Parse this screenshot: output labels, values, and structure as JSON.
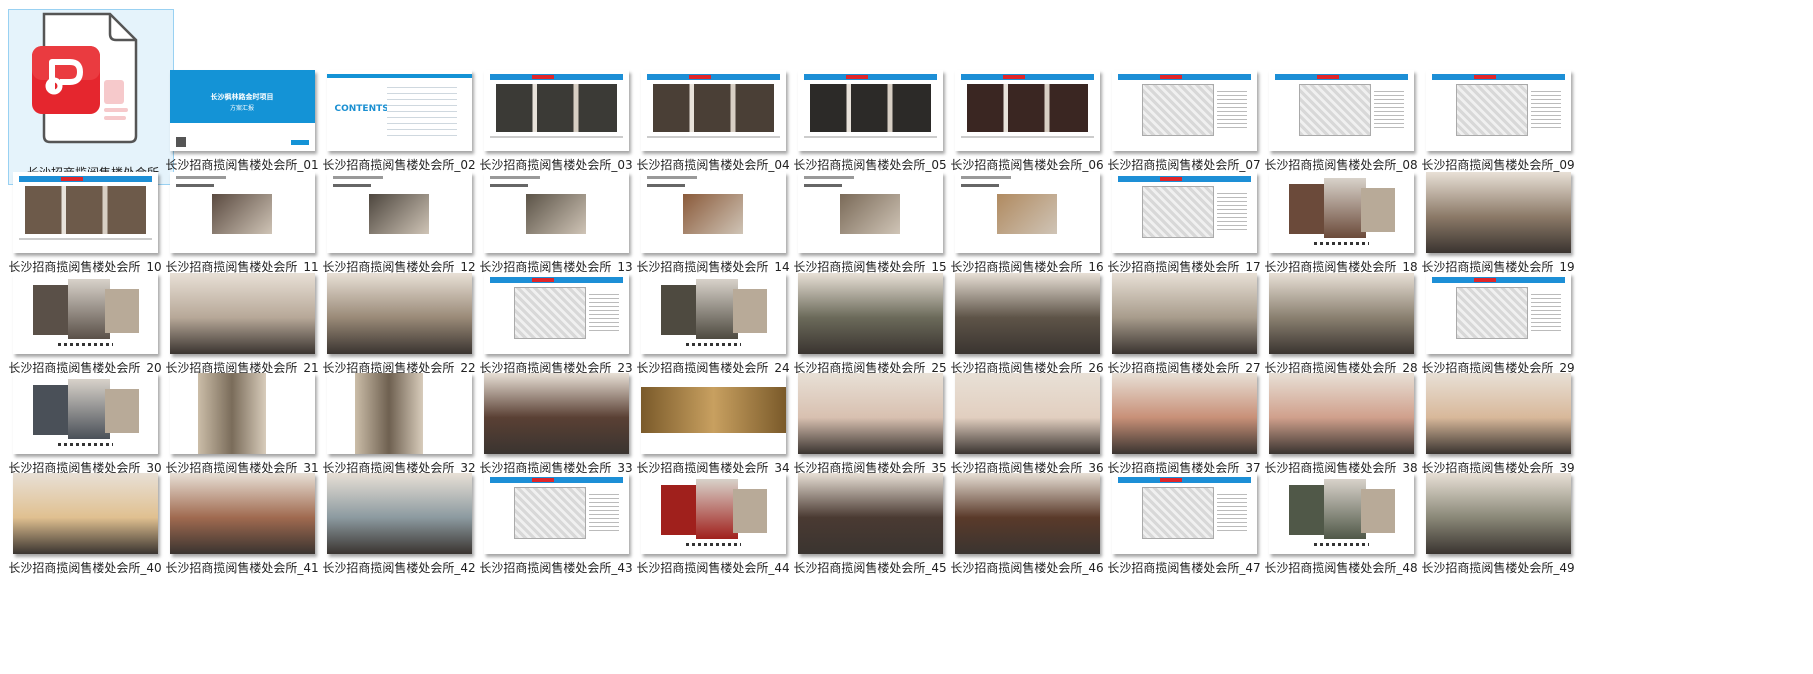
{
  "selected_file": {
    "name": "长沙招商揽阅售楼处会所",
    "icon": "pdf-file-icon",
    "accent": "#e5262e"
  },
  "thumbnails": [
    {
      "name": "长沙招商揽阅售楼处会所_01",
      "kind": "blue-cover",
      "title": "长沙枫林路金时项目",
      "subtitle": "方案汇报"
    },
    {
      "name": "长沙招商揽阅售楼处会所_02",
      "kind": "contents",
      "word": "CONTENTS"
    },
    {
      "name": "长沙招商揽阅售楼处会所_03",
      "kind": "header-photo",
      "tone": "#3b3a36"
    },
    {
      "name": "长沙招商揽阅售楼处会所_04",
      "kind": "header-photo",
      "tone": "#4a3f36"
    },
    {
      "name": "长沙招商揽阅售楼处会所_05",
      "kind": "header-photo",
      "tone": "#2c2a28"
    },
    {
      "name": "长沙招商揽阅售楼处会所_06",
      "kind": "header-photo",
      "tone": "#3a2622"
    },
    {
      "name": "长沙招商揽阅售楼处会所_07",
      "kind": "header-plan"
    },
    {
      "name": "长沙招商揽阅售楼处会所_08",
      "kind": "header-plan"
    },
    {
      "name": "长沙招商揽阅售楼处会所_09",
      "kind": "header-plan"
    },
    {
      "name": "长沙招商揽阅售楼处会所_10",
      "kind": "header-photo",
      "tone": "#6d5a4a"
    },
    {
      "name": "长沙招商揽阅售楼处会所_11",
      "kind": "doc",
      "tone": "#5a4a40"
    },
    {
      "name": "长沙招商揽阅售楼处会所_12",
      "kind": "doc",
      "tone": "#4d463e"
    },
    {
      "name": "长沙招商揽阅售楼处会所_13",
      "kind": "doc",
      "tone": "#5b5347"
    },
    {
      "name": "长沙招商揽阅售楼处会所_14",
      "kind": "doc",
      "tone": "#8a5a3a"
    },
    {
      "name": "长沙招商揽阅售楼处会所_15",
      "kind": "doc",
      "tone": "#7a6a58"
    },
    {
      "name": "长沙招商揽阅售楼处会所_16",
      "kind": "doc",
      "tone": "#b08a60"
    },
    {
      "name": "长沙招商揽阅售楼处会所_17",
      "kind": "header-plan"
    },
    {
      "name": "长沙招商揽阅售楼处会所_18",
      "kind": "collage",
      "tone": "#6b4a3a"
    },
    {
      "name": "长沙招商揽阅售楼处会所_19",
      "kind": "render",
      "tone": "#8c7a68"
    },
    {
      "name": "长沙招商揽阅售楼处会所_20",
      "kind": "collage",
      "tone": "#5a5048"
    },
    {
      "name": "长沙招商揽阅售楼处会所_21",
      "kind": "render",
      "tone": "#b7a898"
    },
    {
      "name": "长沙招商揽阅售楼处会所_22",
      "kind": "render",
      "tone": "#9a8a78"
    },
    {
      "name": "长沙招商揽阅售楼处会所_23",
      "kind": "header-plan"
    },
    {
      "name": "长沙招商揽阅售楼处会所_24",
      "kind": "collage",
      "tone": "#4e4a40"
    },
    {
      "name": "长沙招商揽阅售楼处会所_25",
      "kind": "render",
      "tone": "#6b6a5a"
    },
    {
      "name": "长沙招商揽阅售楼处会所_26",
      "kind": "render",
      "tone": "#5e5448"
    },
    {
      "name": "长沙招商揽阅售楼处会所_27",
      "kind": "render",
      "tone": "#a89c8c"
    },
    {
      "name": "长沙招商揽阅售楼处会所_28",
      "kind": "render",
      "tone": "#8a8070"
    },
    {
      "name": "长沙招商揽阅售楼处会所_29",
      "kind": "header-plan"
    },
    {
      "name": "长沙招商揽阅售楼处会所_30",
      "kind": "collage",
      "tone": "#4a5058"
    },
    {
      "name": "长沙招商揽阅售楼处会所_31",
      "kind": "render-narrow",
      "tone": "#7a6c5a"
    },
    {
      "name": "长沙招商揽阅售楼处会所_32",
      "kind": "render-narrow",
      "tone": "#6e6050"
    },
    {
      "name": "长沙招商揽阅售楼处会所_33",
      "kind": "render",
      "tone": "#5a4034"
    },
    {
      "name": "长沙招商揽阅售楼处会所_34",
      "kind": "banner",
      "tone": "#7a5a2a"
    },
    {
      "name": "长沙招商揽阅售楼处会所_35",
      "kind": "render",
      "tone": "#d8c0b0"
    },
    {
      "name": "长沙招商揽阅售楼处会所_36",
      "kind": "render",
      "tone": "#e2cfc0"
    },
    {
      "name": "长沙招商揽阅售楼处会所_37",
      "kind": "render",
      "tone": "#c89078"
    },
    {
      "name": "长沙招商揽阅售楼处会所_38",
      "kind": "render",
      "tone": "#d0a08c"
    },
    {
      "name": "长沙招商揽阅售楼处会所_39",
      "kind": "render",
      "tone": "#d8b89a"
    },
    {
      "name": "长沙招商揽阅售楼处会所_40",
      "kind": "render",
      "tone": "#e0c090"
    },
    {
      "name": "长沙招商揽阅售楼处会所_41",
      "kind": "render",
      "tone": "#a06a50"
    },
    {
      "name": "长沙招商揽阅售楼处会所_42",
      "kind": "render",
      "tone": "#8c9aa0"
    },
    {
      "name": "长沙招商揽阅售楼处会所_43",
      "kind": "header-plan"
    },
    {
      "name": "长沙招商揽阅售楼处会所_44",
      "kind": "collage",
      "tone": "#a0201c"
    },
    {
      "name": "长沙招商揽阅售楼处会所_45",
      "kind": "render",
      "tone": "#4a3a32"
    },
    {
      "name": "长沙招商揽阅售楼处会所_46",
      "kind": "render",
      "tone": "#5a3a2a"
    },
    {
      "name": "长沙招商揽阅售楼处会所_47",
      "kind": "header-plan"
    },
    {
      "name": "长沙招商揽阅售楼处会所_48",
      "kind": "collage",
      "tone": "#505848"
    },
    {
      "name": "长沙招商揽阅售楼处会所_49",
      "kind": "render",
      "tone": "#8a8878"
    }
  ]
}
